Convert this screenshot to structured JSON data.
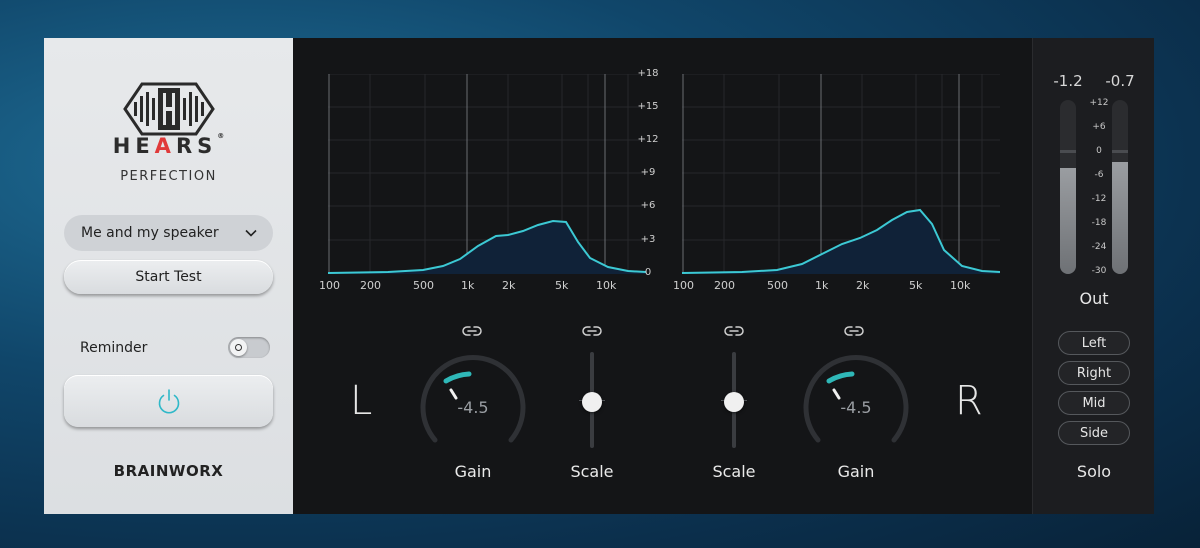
{
  "left_panel": {
    "brand_name": "HEARS",
    "brand_name_pre": "HE",
    "brand_name_accent": "A",
    "brand_name_post": "RS",
    "registered_mark": "®",
    "product_name": "PERFECTION",
    "profile_select": {
      "value": "Me and my speaker"
    },
    "start_test_label": "Start Test",
    "reminder_label": "Reminder",
    "reminder_on": false,
    "footer_brand": "BRAINWORX"
  },
  "graphs": {
    "x_ticks": [
      "100",
      "200",
      "500",
      "1k",
      "2k",
      "5k",
      "10k"
    ],
    "y_ticks": [
      "+18",
      "+15",
      "+12",
      "+9",
      "+6",
      "+3",
      "0"
    ],
    "curve_color": "#3cc9d4"
  },
  "controls": {
    "left_channel_label": "L",
    "right_channel_label": "R",
    "left_gain": {
      "label": "Gain",
      "value": "-4.5"
    },
    "left_scale": {
      "label": "Scale",
      "level": 0.5
    },
    "right_scale": {
      "label": "Scale",
      "level": 0.5
    },
    "right_gain": {
      "label": "Gain",
      "value": "-4.5"
    },
    "accent_color": "#2fb8b8"
  },
  "output": {
    "left_meter_value": "-1.2",
    "right_meter_value": "-0.7",
    "meter_scale": [
      "+12",
      "+6",
      "0",
      "-6",
      "-12",
      "-18",
      "-24",
      "-30"
    ],
    "out_label": "Out",
    "solo_buttons": [
      "Left",
      "Right",
      "Mid",
      "Side"
    ],
    "solo_label": "Solo"
  }
}
